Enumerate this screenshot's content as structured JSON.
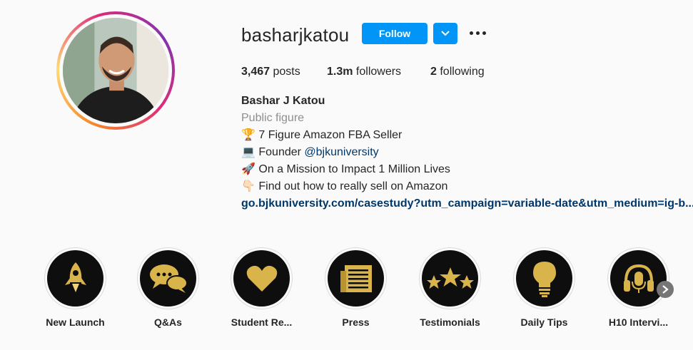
{
  "profile": {
    "username": "basharjkatou",
    "follow_label": "Follow",
    "stats": {
      "posts_count": "3,467",
      "posts_label": "posts",
      "followers_count": "1.3m",
      "followers_label": "followers",
      "following_count": "2",
      "following_label": "following"
    },
    "bio": {
      "name": "Bashar J Katou",
      "category": "Public figure",
      "line1": "🏆 7 Figure Amazon FBA Seller",
      "line2_prefix": "💻 Founder ",
      "line2_mention": "@bjkuniversity",
      "line3": "🚀 On a Mission to Impact 1 Million Lives",
      "line4": "👇🏻 Find out how to really sell on Amazon",
      "link": "go.bjkuniversity.com/casestudy?utm_campaign=variable-date&utm_medium=ig-b..."
    }
  },
  "highlights": [
    {
      "label": "New Launch",
      "icon": "rocket-icon"
    },
    {
      "label": "Q&As",
      "icon": "chat-bubbles-icon"
    },
    {
      "label": "Student Re...",
      "icon": "heart-icon"
    },
    {
      "label": "Press",
      "icon": "newspaper-icon"
    },
    {
      "label": "Testimonials",
      "icon": "three-stars-icon"
    },
    {
      "label": "Daily Tips",
      "icon": "lightbulb-icon"
    },
    {
      "label": "H10 Intervi...",
      "icon": "headphones-mic-icon"
    }
  ],
  "colors": {
    "accent": "#0095f6",
    "gold": "#d9b44a",
    "link": "#00376b",
    "secondary_text": "#8e8e8e"
  }
}
